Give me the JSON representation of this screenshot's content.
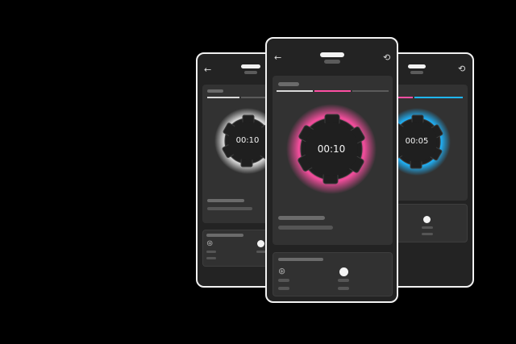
{
  "screens": {
    "left": {
      "timer": "00:10",
      "ring_color": "#e8e8e8"
    },
    "center": {
      "timer": "00:10",
      "ring_color": "#ff4fa3"
    },
    "right": {
      "timer": "00:05",
      "ring_color": "#1fb6ff"
    }
  },
  "icons": {
    "back": "←",
    "reset": "⟲",
    "ball": "⊛"
  },
  "colors": {
    "background": "#000000",
    "screen": "#232323",
    "card": "#323232",
    "accent_pink": "#ff4fa3",
    "accent_blue": "#1fb6ff"
  }
}
